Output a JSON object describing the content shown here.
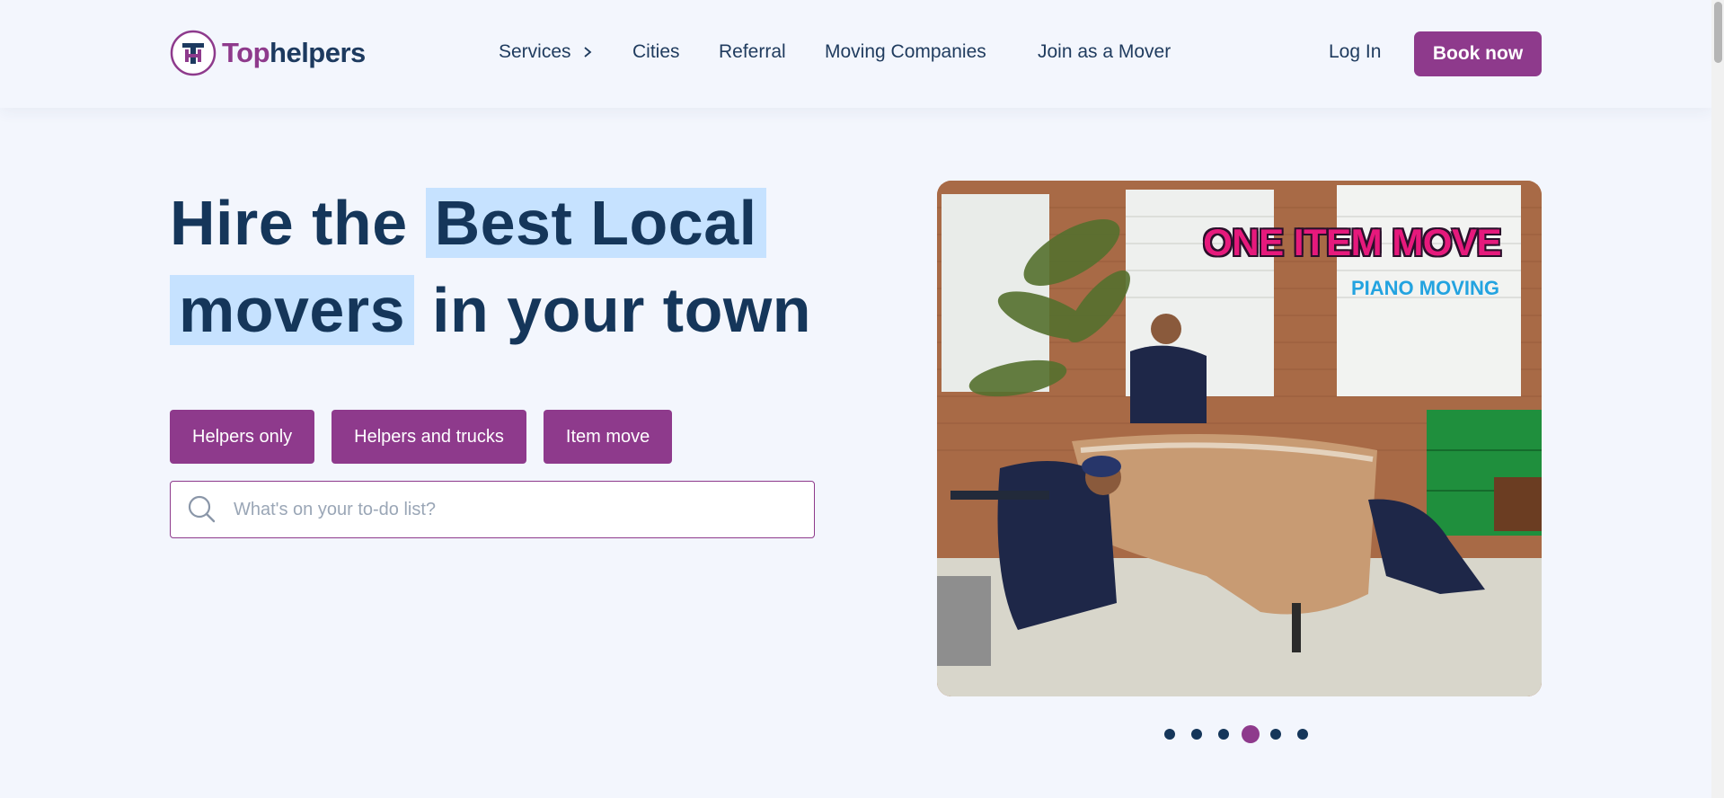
{
  "header": {
    "logo_top": "Top",
    "logo_helpers": "helpers",
    "nav": [
      {
        "label": "Services"
      },
      {
        "label": "Cities"
      },
      {
        "label": "Referral"
      },
      {
        "label": "Moving Companies"
      },
      {
        "label": "Join as a Mover"
      }
    ],
    "login_label": "Log In",
    "book_label": "Book now"
  },
  "hero": {
    "title_pre": "Hire the",
    "title_hl1": "Best Local",
    "title_hl2": "movers",
    "title_post": "in your town",
    "chips": [
      "Helpers only",
      "Helpers and trucks",
      "Item move"
    ],
    "search_placeholder": "What's on your to-do list?",
    "image_overlay_1": "ONE ITEM MOVE",
    "image_overlay_2": "PIANO MOVING"
  },
  "carousel": {
    "dot_count": 6,
    "active_index": 3
  },
  "colors": {
    "brand": "#8e3a8c",
    "navy": "#15365a",
    "highlight": "#c6e2ff",
    "background": "#f3f6fd"
  },
  "icons": [
    "logo-mark-icon",
    "chevron-right-icon",
    "search-icon"
  ]
}
